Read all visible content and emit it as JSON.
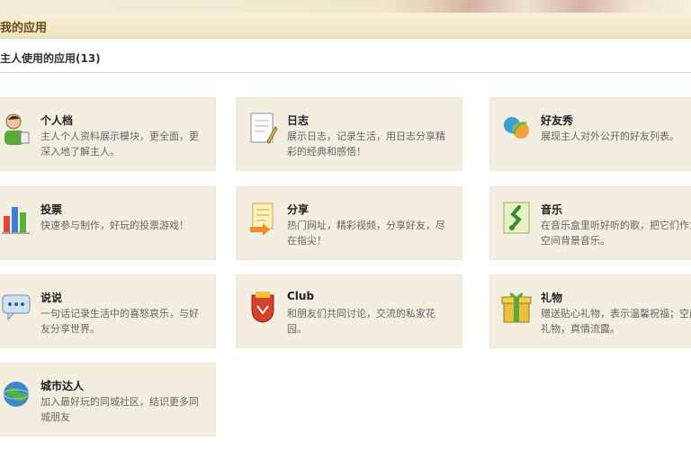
{
  "header": {
    "title": "我的应用"
  },
  "subtitle": "主人使用的应用(13)",
  "apps": [
    {
      "title": "个人档",
      "desc": "主人个人资料展示模块，更全面，更深入地了解主人。",
      "icon": "person-icon"
    },
    {
      "title": "日志",
      "desc": "展示日志，记录生活，用日志分享精彩的经典和感悟！",
      "icon": "notebook-icon"
    },
    {
      "title": "好友秀",
      "desc": "展现主人对外公开的好友列表。",
      "icon": "friends-show-icon"
    },
    {
      "title": "投票",
      "desc": "快速参与制作，好玩的投票游戏！",
      "icon": "vote-chart-icon"
    },
    {
      "title": "分享",
      "desc": "热门网址，精彩视频，分享好友，尽在指尖！",
      "icon": "share-notes-icon"
    },
    {
      "title": "音乐",
      "desc": "在音乐盒里听好听的歌，把它们作为空间背景音乐。",
      "icon": "music-note-icon"
    },
    {
      "title": "说说",
      "desc": "一句话记录生活中的喜怒哀乐，与好友分享世界。",
      "icon": "speech-bubble-icon"
    },
    {
      "title": "Club",
      "desc": "和朋友们共同讨论，交流的私家花园。",
      "icon": "club-logo-icon"
    },
    {
      "title": "礼物",
      "desc": "赠送贴心礼物，表示温馨祝福；空间礼物，真情流露。",
      "icon": "gift-box-icon"
    },
    {
      "title": "城市达人",
      "desc": "加入最好玩的同城社区，结识更多同城朋友",
      "icon": "city-globe-icon"
    }
  ]
}
